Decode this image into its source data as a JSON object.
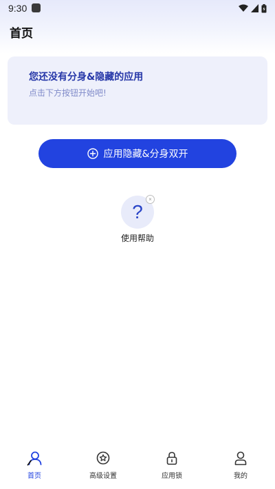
{
  "status_bar": {
    "time": "9:30",
    "icons": [
      "notification-icon",
      "wifi-icon",
      "signal-icon",
      "battery-icon"
    ]
  },
  "header": {
    "title": "首页"
  },
  "empty_state": {
    "title": "您还没有分身&隐藏的应用",
    "subtitle": "点击下方按钮开始吧!"
  },
  "primary_action": {
    "label": "应用隐藏&分身双开",
    "icon": "plus-circle-icon"
  },
  "help": {
    "label": "使用帮助",
    "icon": "question-icon",
    "glyph": "?"
  },
  "bottom_nav": {
    "items": [
      {
        "label": "首页",
        "icon": "home-user-icon",
        "active": true
      },
      {
        "label": "高级设置",
        "icon": "star-settings-icon",
        "active": false
      },
      {
        "label": "应用锁",
        "icon": "lock-icon",
        "active": false
      },
      {
        "label": "我的",
        "icon": "profile-icon",
        "active": false
      }
    ]
  },
  "colors": {
    "accent": "#2243e0",
    "card_background": "#eef0fb",
    "card_title": "#2637a8",
    "card_subtitle": "#7f8ac9"
  }
}
